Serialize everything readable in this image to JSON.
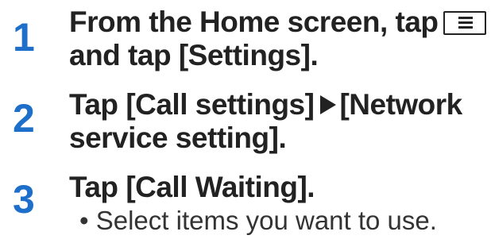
{
  "steps": [
    {
      "number": "1",
      "line1_before_key": "From the Home screen, tap",
      "line2": "and tap [Settings]."
    },
    {
      "number": "2",
      "line1_before_arrow": "Tap [Call settings]",
      "line1_after_arrow": "[Network",
      "line2": "service setting]."
    },
    {
      "number": "3",
      "line1": "Tap [Call Waiting].",
      "bullet": "• Select items you want to use."
    }
  ],
  "icons": {
    "menu_key": "menu-key-icon",
    "arrow": "right-triangle-arrow-icon"
  },
  "colors": {
    "step_number": "#1e6fc9",
    "text": "#222222"
  }
}
